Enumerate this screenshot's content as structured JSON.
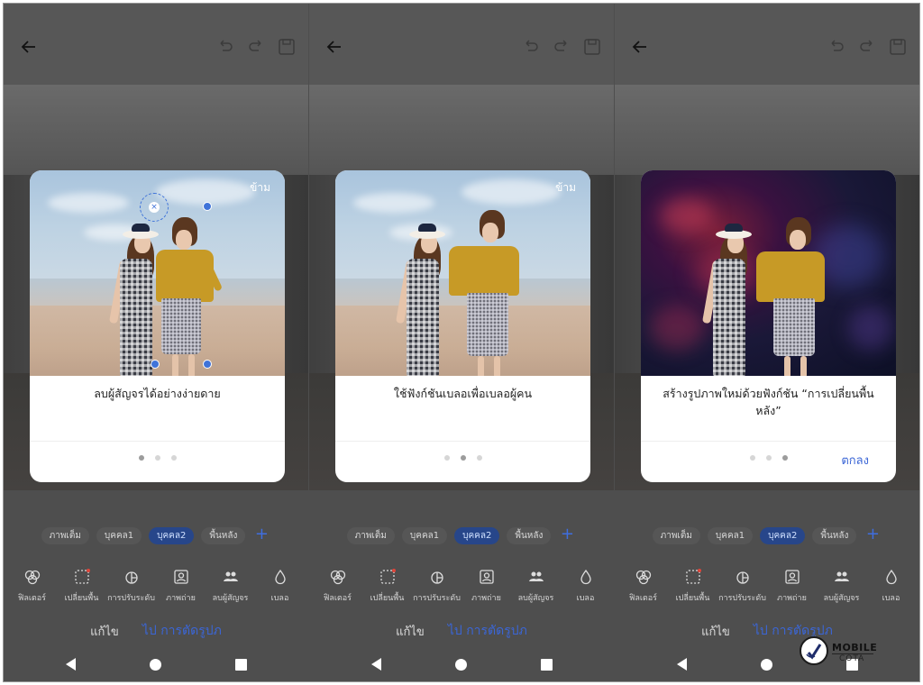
{
  "panels": [
    {
      "dialog": {
        "skip": "ข้าม",
        "text": "ลบผู้สัญจรได้อย่างง่ายดาย",
        "active_dot": 0,
        "ok": ""
      },
      "tabs": [
        "ภาพเต็ม",
        "บุคคล1",
        "บุคคล2",
        "พื้นหลัง"
      ],
      "active_tab": 2,
      "tools": [
        {
          "icon": "filter-icon",
          "label": "ฟิลเตอร์"
        },
        {
          "icon": "background-change-icon",
          "label": "เปลี่ยนพื้น"
        },
        {
          "icon": "adjust-icon",
          "label": "การปรับระดับ"
        },
        {
          "icon": "portrait-icon",
          "label": "ภาพถ่าย"
        },
        {
          "icon": "remove-passerby-icon",
          "label": "ลบผู้สัญจร"
        },
        {
          "icon": "blur-icon",
          "label": "เบลอ"
        }
      ],
      "edit": "แก้ไข",
      "crop": "ไป การตัดรูปภ"
    },
    {
      "dialog": {
        "skip": "ข้าม",
        "text": "ใช้ฟังก์ชันเบลอเพื่อเบลอผู้คน",
        "active_dot": 1,
        "ok": ""
      },
      "tabs": [
        "ภาพเต็ม",
        "บุคคล1",
        "บุคคล2",
        "พื้นหลัง"
      ],
      "active_tab": 2,
      "tools": [
        {
          "icon": "filter-icon",
          "label": "ฟิลเตอร์"
        },
        {
          "icon": "background-change-icon",
          "label": "เปลี่ยนพื้น"
        },
        {
          "icon": "adjust-icon",
          "label": "การปรับระดับ"
        },
        {
          "icon": "portrait-icon",
          "label": "ภาพถ่าย"
        },
        {
          "icon": "remove-passerby-icon",
          "label": "ลบผู้สัญจร"
        },
        {
          "icon": "blur-icon",
          "label": "เบลอ"
        }
      ],
      "edit": "แก้ไข",
      "crop": "ไป การตัดรูปภ"
    },
    {
      "dialog": {
        "skip": "",
        "text": "สร้างรูปภาพใหม่ด้วยฟังก์ชัน “การเปลี่ยนพื้นหลัง”",
        "active_dot": 2,
        "ok": "ตกลง"
      },
      "tabs": [
        "ภาพเต็ม",
        "บุคคล1",
        "บุคคล2",
        "พื้นหลัง"
      ],
      "active_tab": 2,
      "tools": [
        {
          "icon": "filter-icon",
          "label": "ฟิลเตอร์"
        },
        {
          "icon": "background-change-icon",
          "label": "เปลี่ยนพื้น"
        },
        {
          "icon": "adjust-icon",
          "label": "การปรับระดับ"
        },
        {
          "icon": "portrait-icon",
          "label": "ภาพถ่าย"
        },
        {
          "icon": "remove-passerby-icon",
          "label": "ลบผู้สัญจร"
        },
        {
          "icon": "blur-icon",
          "label": "เบลอ"
        }
      ],
      "edit": "แก้ไข",
      "crop": "ไป การตัดรูปภ"
    }
  ],
  "watermark": {
    "line1": "MOBILE",
    "line2": "COTA"
  },
  "colors": {
    "accent": "#3b66d6",
    "active_tab_bg": "#27468a",
    "dim_overlay": "#4e4e4e",
    "dialog_bg": "#ffffff"
  }
}
